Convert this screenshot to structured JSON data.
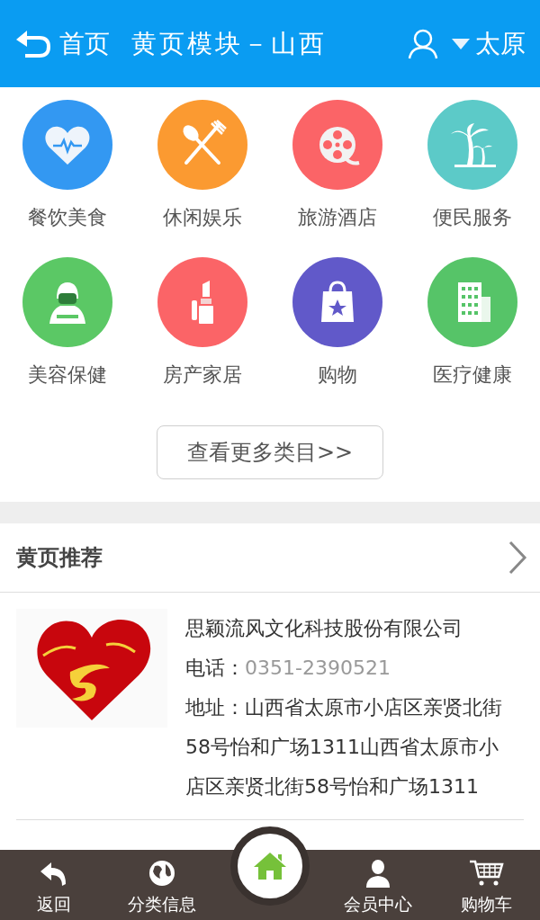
{
  "header": {
    "back_label": "首页",
    "title": "黄页模块－山西",
    "city": "太原"
  },
  "categories": [
    {
      "label": "餐饮美食",
      "color": "#3398f2"
    },
    {
      "label": "休闲娱乐",
      "color": "#fb9a31"
    },
    {
      "label": "旅游酒店",
      "color": "#fb6467"
    },
    {
      "label": "便民服务",
      "color": "#5ccac8"
    },
    {
      "label": "美容保健",
      "color": "#5bc865"
    },
    {
      "label": "房产家居",
      "color": "#fb6467"
    },
    {
      "label": "购物",
      "color": "#6159c9"
    },
    {
      "label": "医疗健康",
      "color": "#56c468"
    }
  ],
  "more_button": "查看更多类目>>",
  "section": {
    "title": "黄页推荐"
  },
  "listings": [
    {
      "name": "思颖流风文化科技股份有限公司",
      "phone_label": "电话：",
      "phone": "0351-2390521",
      "address": "地址：山西省太原市小店区亲贤北街58号怡和广场1311山西省太原市小店区亲贤北街58号怡和广场1311"
    }
  ],
  "nav": [
    {
      "label": "返回"
    },
    {
      "label": "分类信息"
    },
    {
      "label": "会员中心"
    },
    {
      "label": "购物车"
    }
  ]
}
